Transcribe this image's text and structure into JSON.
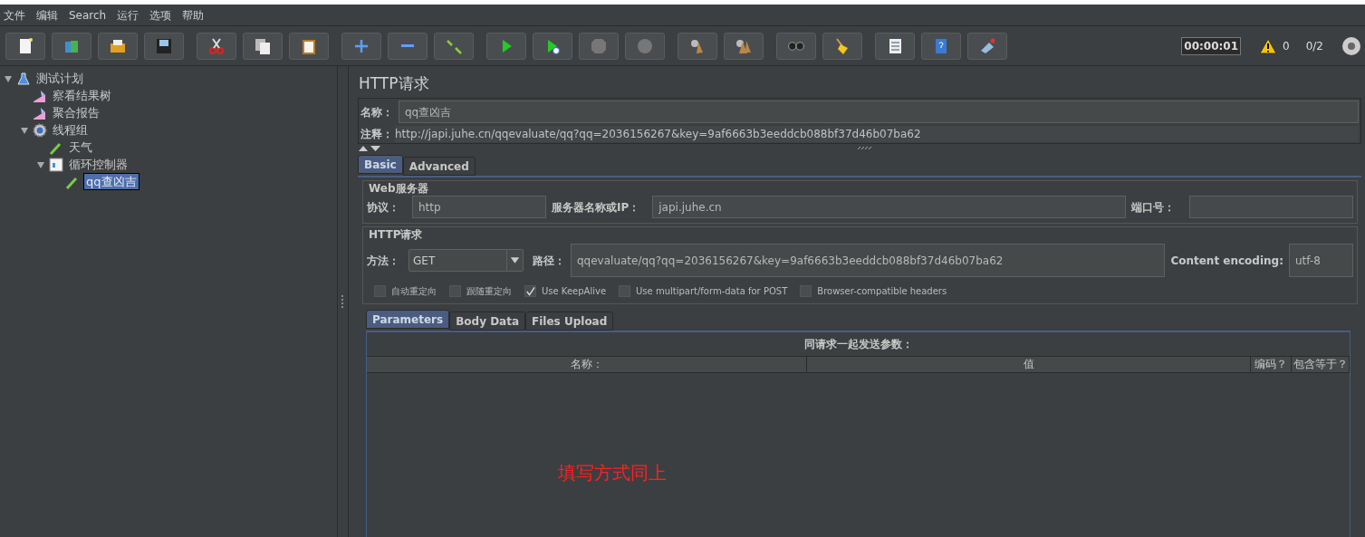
{
  "menu": [
    "文件",
    "编辑",
    "Search",
    "运行",
    "选项",
    "帮助"
  ],
  "status": {
    "timer": "00:00:01",
    "warnings": "0",
    "threads": "0/2"
  },
  "tree": [
    {
      "label": "测试计划",
      "kind": "plan",
      "expanded": true,
      "selected": false,
      "children": [
        {
          "label": "察看结果树",
          "kind": "listener",
          "selected": false
        },
        {
          "label": "聚合报告",
          "kind": "listener",
          "selected": false
        },
        {
          "label": "线程组",
          "kind": "threads",
          "expanded": true,
          "selected": false,
          "children": [
            {
              "label": "天气",
              "kind": "sampler",
              "selected": false
            },
            {
              "label": "循环控制器",
              "kind": "controller",
              "expanded": true,
              "selected": false,
              "children": [
                {
                  "label": "qq查凶吉",
                  "kind": "sampler",
                  "selected": true
                }
              ]
            }
          ]
        }
      ]
    }
  ],
  "panel": {
    "title": "HTTP请求",
    "name_label": "名称：",
    "name_value": "qq查凶吉",
    "comment_label": "注释：",
    "comment_value": "http://japi.juhe.cn/qqevaluate/qq?qq=2036156267&key=9af6663b3eeddcb088bf37d46b07ba62"
  },
  "tabs": [
    {
      "label": "Basic",
      "selected": true
    },
    {
      "label": "Advanced",
      "selected": false
    }
  ],
  "web_server": {
    "title": "Web服务器",
    "protocol_label": "协议：",
    "protocol": "http",
    "server_label": "服务器名称或IP：",
    "server": "japi.juhe.cn",
    "port_label": "端口号："
  },
  "http_request": {
    "title": "HTTP请求",
    "method_label": "方法：",
    "method": "GET",
    "path_label": "路径：",
    "path": "qqevaluate/qq?qq=2036156267&key=9af6663b3eeddcb088bf37d46b07ba62",
    "encoding_label": "Content encoding:",
    "encoding": "utf-8"
  },
  "options": [
    {
      "label": "自动重定向",
      "checked": false
    },
    {
      "label": "跟随重定向",
      "checked": false
    },
    {
      "label": "Use KeepAlive",
      "checked": true
    },
    {
      "label": "Use multipart/form-data for POST",
      "checked": false
    },
    {
      "label": "Browser-compatible headers",
      "checked": false
    }
  ],
  "sub_tabs": [
    {
      "label": "Parameters",
      "selected": true
    },
    {
      "label": "Body Data",
      "selected": false
    },
    {
      "label": "Files Upload",
      "selected": false
    }
  ],
  "table": {
    "caption": "同请求一起发送参数：",
    "columns": [
      "名称：",
      "值",
      "编码？",
      "包含等于？"
    ]
  },
  "annotation": "填写方式同上"
}
